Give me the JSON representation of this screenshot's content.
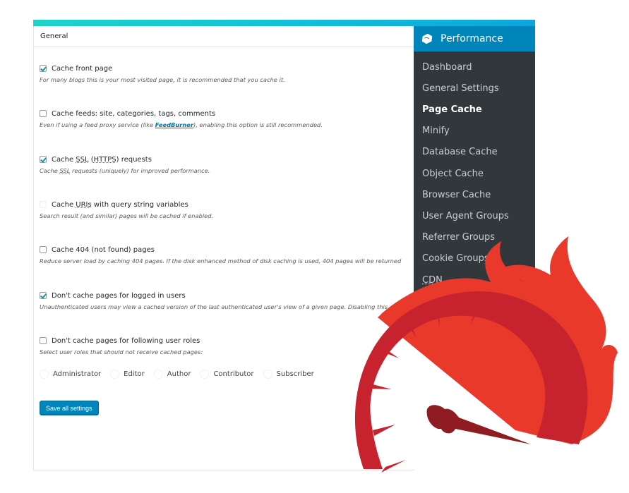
{
  "panel": {
    "title": "General",
    "options": [
      {
        "label": "Cache front page",
        "checked": true,
        "description": "For many blogs this is your most visited page, it is recommended that you cache it."
      },
      {
        "label": "Cache feeds: site, categories, tags, comments",
        "checked": false,
        "description_before": "Even if using a feed proxy service (like ",
        "description_link": "FeedBurner",
        "description_after": "), enabling this option is still recommended."
      },
      {
        "label_before": "Cache ",
        "label_abbr1": "SSL",
        "label_mid": " (",
        "label_abbr2": "HTTPS",
        "label_after": ") requests",
        "checked": true,
        "description_before": "Cache ",
        "description_abbr": "SSL",
        "description_after": " requests (uniquely) for improved performance."
      },
      {
        "label_before": "Cache ",
        "label_abbr": "URIs",
        "label_after": " with query string variables",
        "checked": false,
        "description": "Search result (and similar) pages will be cached if enabled."
      },
      {
        "label": "Cache 404 (not found) pages",
        "checked": false,
        "description": "Reduce server load by caching 404 pages. If the disk enhanced method of disk caching is used, 404 pages will be returned"
      },
      {
        "label": "Don't cache pages for logged in users",
        "checked": true,
        "description": "Unauthenticated users may view a cached version of the last authenticated user's view of a given page. Disabling this"
      },
      {
        "label": "Don't cache pages for following user roles",
        "checked": false,
        "description": "Select user roles that should not receive cached pages:"
      }
    ],
    "roles": [
      "Administrator",
      "Editor",
      "Author",
      "Contributor",
      "Subscriber"
    ],
    "save_label": "Save all settings"
  },
  "sidebar": {
    "header_title": "Performance",
    "header_icon": "w3tc-logo-icon",
    "active_item": "Page Cache",
    "items": [
      "Dashboard",
      "General Settings",
      "Page Cache",
      "Minify",
      "Database Cache",
      "Object Cache",
      "Browser Cache",
      "User Agent Groups",
      "Referrer Groups",
      "Cookie Groups",
      "CDN"
    ]
  },
  "colors": {
    "accent": "#0085ba",
    "sidebar_bg": "#32373c",
    "flame": "#e8392b",
    "gauge": "#c7232e",
    "needle": "#8e1c22"
  }
}
